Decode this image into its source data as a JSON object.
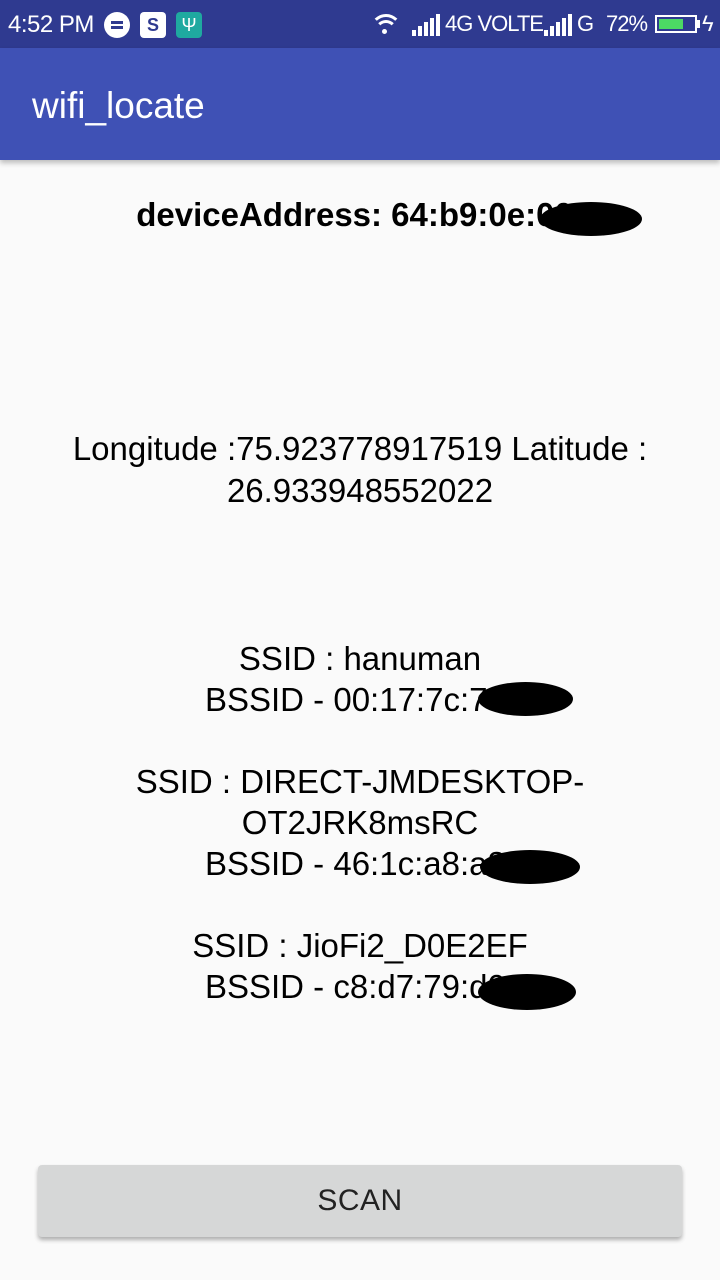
{
  "status_bar": {
    "time": "4:52 PM",
    "network_4g": "4G VOLTE",
    "network_g": "G",
    "battery_percent": "72%",
    "battery_level": 0.72,
    "icons": [
      "message-icon",
      "sync-icon",
      "usb-icon",
      "wifi-icon",
      "signal-icon",
      "battery-icon",
      "charging-icon"
    ]
  },
  "app_bar": {
    "title": "wifi_locate"
  },
  "device": {
    "address": "deviceAddress: 64:b9:0e:00:"
  },
  "location": {
    "text": "Longitude :75.923778917519   Latitude : 26.933948552022"
  },
  "networks": [
    {
      "ssid": "SSID : hanuman",
      "bssid": "BSSID - 00:17:7c:70:"
    },
    {
      "ssid": "SSID : DIRECT-JMDESKTOP-OT2JRK8msRC",
      "bssid": "BSSID - 46:1c:a8:a8:"
    },
    {
      "ssid": "SSID : JioFi2_D0E2EF",
      "bssid": "BSSID - c8:d7:79:d0:"
    }
  ],
  "scan_button": {
    "label": "SCAN"
  },
  "colors": {
    "status_bar": "#2f3a90",
    "app_bar": "#3f51b5",
    "background": "#fafafa",
    "button": "#d6d7d7",
    "battery_fill": "#4cd964"
  }
}
